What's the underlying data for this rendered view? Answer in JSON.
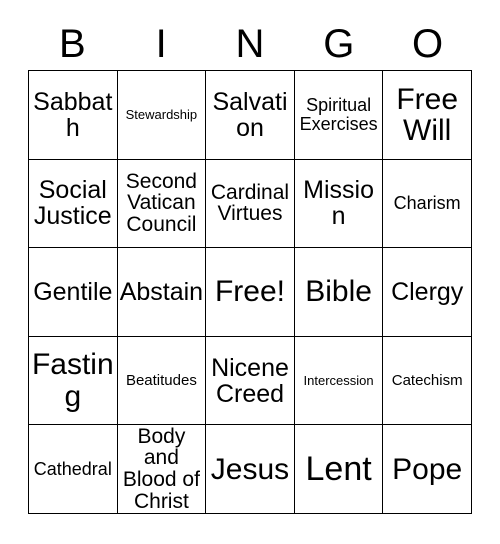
{
  "card": {
    "header": {
      "letters": [
        "B",
        "I",
        "N",
        "G",
        "O"
      ]
    },
    "grid": {
      "rows": 5,
      "columns": 5,
      "free_space_index": 12,
      "cells": [
        {
          "label": "Sabbath",
          "size": "l"
        },
        {
          "label": "Stewardship",
          "size": "xxs"
        },
        {
          "label": "Salvation",
          "size": "l"
        },
        {
          "label": "Spiritual Exercises",
          "size": "s"
        },
        {
          "label": "Free Will",
          "size": "xl"
        },
        {
          "label": "Social Justice",
          "size": "l"
        },
        {
          "label": "Second Vatican Council",
          "size": "m"
        },
        {
          "label": "Cardinal Virtues",
          "size": "m"
        },
        {
          "label": "Mission",
          "size": "l"
        },
        {
          "label": "Charism",
          "size": "s"
        },
        {
          "label": "Gentile",
          "size": "l"
        },
        {
          "label": "Abstain",
          "size": "l"
        },
        {
          "label": "Free!",
          "size": "xl"
        },
        {
          "label": "Bible",
          "size": "xl"
        },
        {
          "label": "Clergy",
          "size": "l"
        },
        {
          "label": "Fasting",
          "size": "xl"
        },
        {
          "label": "Beatitudes",
          "size": "xs"
        },
        {
          "label": "Nicene Creed",
          "size": "l"
        },
        {
          "label": "Intercession",
          "size": "xxs"
        },
        {
          "label": "Catechism",
          "size": "xs"
        },
        {
          "label": "Cathedral",
          "size": "s"
        },
        {
          "label": "Body and Blood of Christ",
          "size": "m"
        },
        {
          "label": "Jesus",
          "size": "xl"
        },
        {
          "label": "Lent",
          "size": "xxl"
        },
        {
          "label": "Pope",
          "size": "xl"
        }
      ]
    },
    "colors": {
      "background": "#ffffff",
      "border": "#000000",
      "text": "#000000"
    }
  }
}
